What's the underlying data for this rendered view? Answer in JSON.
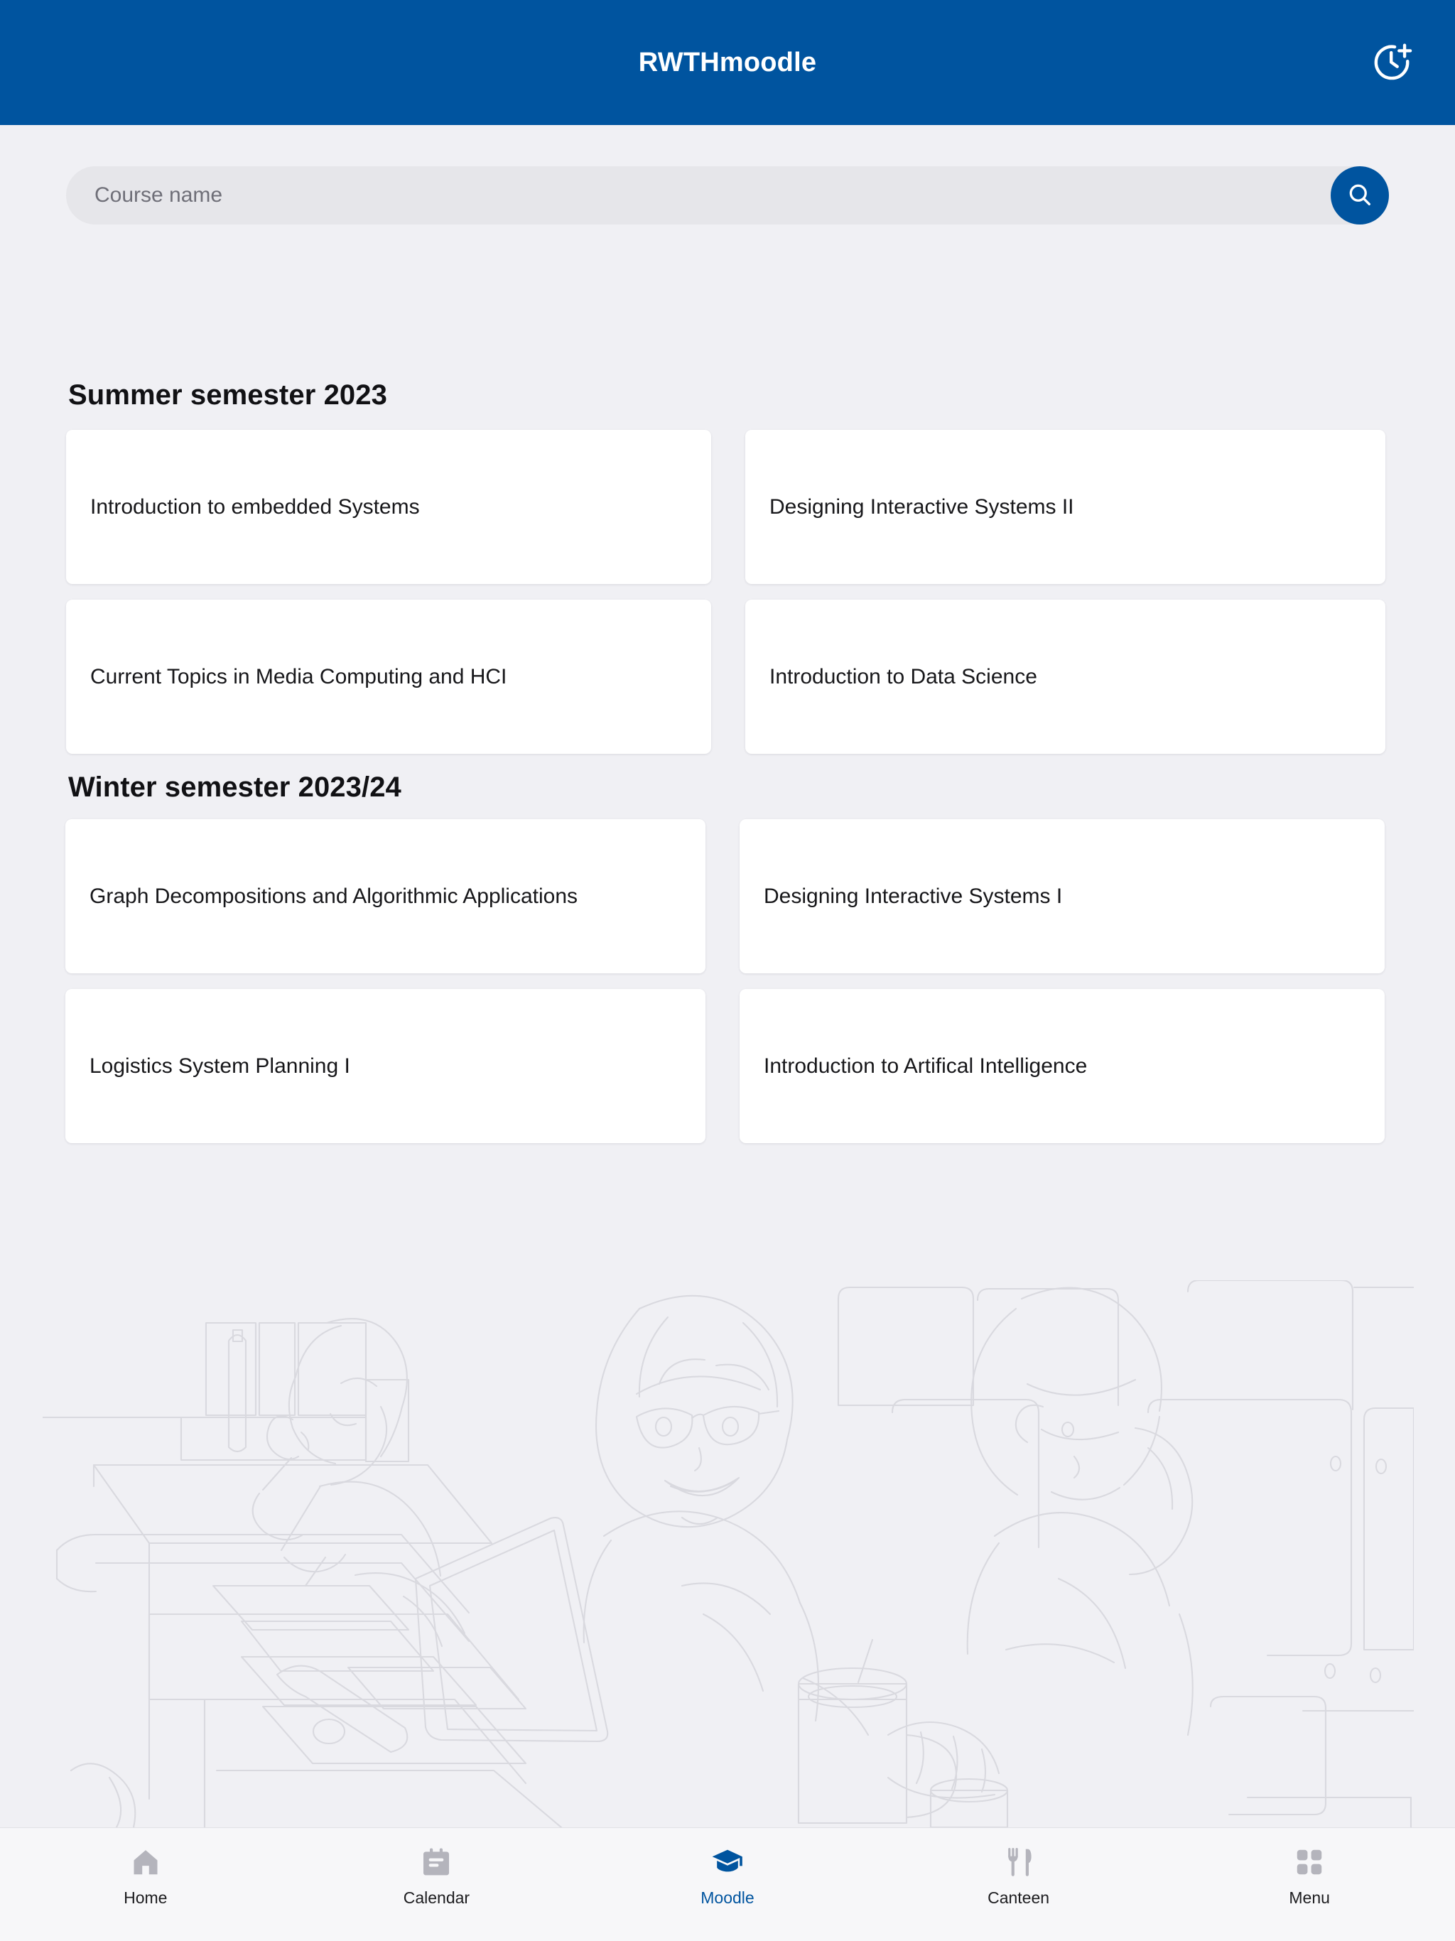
{
  "header": {
    "title": "RWTHmoodle",
    "action_icon": "clock-plus-icon",
    "background_color": "#00549F"
  },
  "search": {
    "placeholder": "Course name",
    "value": "",
    "button_icon": "search-icon",
    "button_color": "#00549F"
  },
  "sections": [
    {
      "heading": "Summer semester 2023",
      "courses": [
        {
          "title": "Introduction to embedded Systems"
        },
        {
          "title": "Designing Interactive Systems II"
        },
        {
          "title": "Current Topics in Media Computing and HCI"
        },
        {
          "title": "Introduction to Data Science"
        }
      ]
    },
    {
      "heading": "Winter semester 2023/24",
      "courses": [
        {
          "title": "Graph Decompositions and Algorithmic Applications"
        },
        {
          "title": "Designing Interactive Systems I"
        },
        {
          "title": "Logistics System Planning I"
        },
        {
          "title": "Introduction to Artifical Intelligence"
        }
      ]
    }
  ],
  "illustration": {
    "description": "students-studying-lecture-hall-line-art",
    "line_color": "#d8d8de"
  },
  "bottom_nav": {
    "active_color": "#00549F",
    "inactive_color": "#B4B4BC",
    "items": [
      {
        "label": "Home",
        "icon": "home-icon",
        "active": false
      },
      {
        "label": "Calendar",
        "icon": "calendar-icon",
        "active": false
      },
      {
        "label": "Moodle",
        "icon": "graduation-cap-icon",
        "active": true
      },
      {
        "label": "Canteen",
        "icon": "fork-knife-icon",
        "active": false
      },
      {
        "label": "Menu",
        "icon": "grid-squares-icon",
        "active": false
      }
    ]
  }
}
